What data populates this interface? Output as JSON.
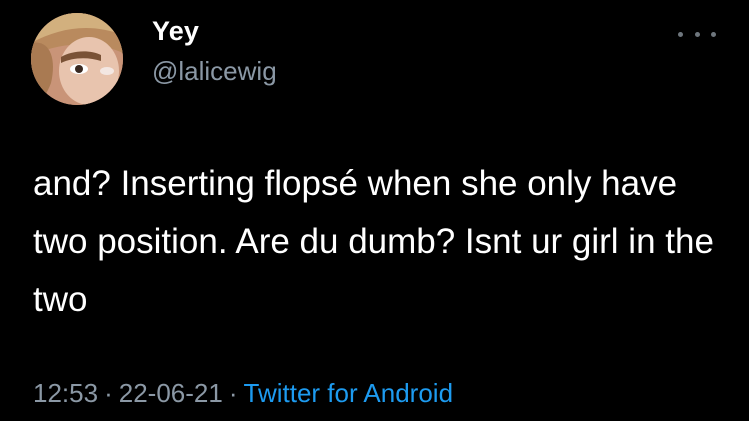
{
  "tweet": {
    "display_name": "Yey",
    "handle": "@lalicewig",
    "text": "and? Inserting flopsé when she only have two position. Are du dumb? Isnt ur girl in the two",
    "time": "12:53",
    "date": "22-06-21",
    "separator": "·",
    "source": "Twitter for Android"
  },
  "icons": {
    "more": "more-options-icon",
    "avatar": "profile-avatar"
  },
  "colors": {
    "background": "#000000",
    "text": "#ffffff",
    "secondary": "#8b98a5",
    "link": "#1d9bf0"
  }
}
